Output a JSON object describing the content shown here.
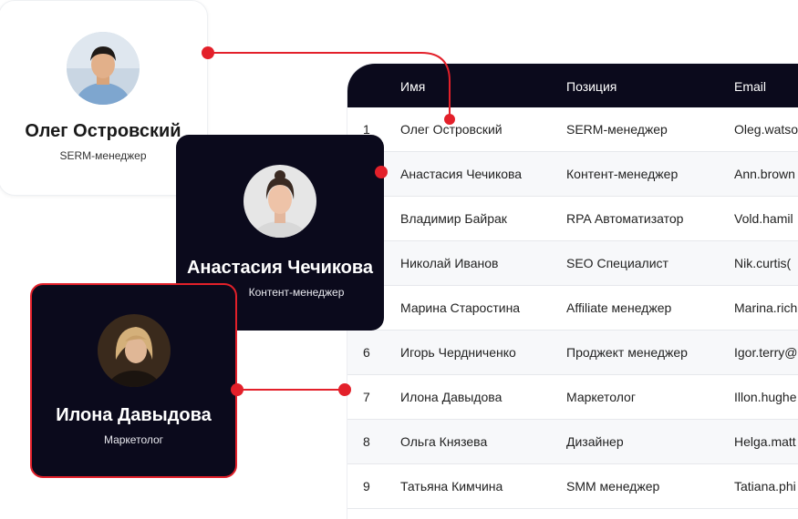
{
  "table": {
    "headers": {
      "name": "Имя",
      "position": "Позиция",
      "email": "Email"
    },
    "rows": [
      {
        "num": "1",
        "name": "Олег Островский",
        "position": "SERM-менеджер",
        "email": "Oleg.watso"
      },
      {
        "num": "",
        "name": "Анастасия Чечикова",
        "position": "Контент-менеджер",
        "email": "Ann.brown"
      },
      {
        "num": "",
        "name": "Владимир Байрак",
        "position": "RPA Автоматизатор",
        "email": "Vold.hamil"
      },
      {
        "num": "",
        "name": "Николай Иванов",
        "position": "SEO Специалист",
        "email": "Nik.curtis("
      },
      {
        "num": "",
        "name": "Марина Старостина",
        "position": "Affiliate менеджер",
        "email": "Marina.rich"
      },
      {
        "num": "6",
        "name": "Игорь Чердниченко",
        "position": "Проджект менеджер",
        "email": "Igor.terry@"
      },
      {
        "num": "7",
        "name": "Илона Давыдова",
        "position": "Маркетолог",
        "email": "Illon.hughe"
      },
      {
        "num": "8",
        "name": "Ольга Князева",
        "position": "Дизайнер",
        "email": "Helga.matt"
      },
      {
        "num": "9",
        "name": "Татьяна Кимчина",
        "position": "SMM менеджер",
        "email": "Tatiana.phi"
      }
    ]
  },
  "cards": {
    "oleg": {
      "name": "Олег Островский",
      "role": "SERM-менеджер"
    },
    "anastasia": {
      "name": "Анастасия Чечикова",
      "role": "Контент-менеджер"
    },
    "ilona": {
      "name": "Илона Давыдова",
      "role": "Маркетолог"
    }
  },
  "colors": {
    "accent": "#e3202a",
    "dark": "#0b0a1c"
  }
}
